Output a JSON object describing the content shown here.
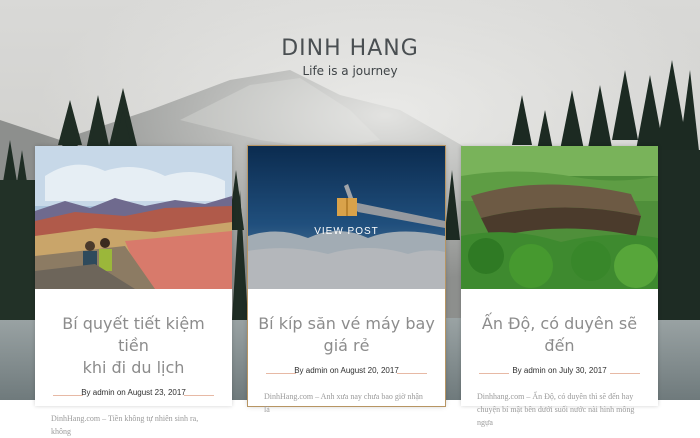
{
  "site": {
    "title": "DINH HANG",
    "tagline": "Life is a journey"
  },
  "colors": {
    "accent_line": "#e7b9a5",
    "title_text": "#4a4f52",
    "view_post_icon": "#d9a24a"
  },
  "posts": [
    {
      "title_line1": "Bí quyết tiết kiệm tiền",
      "title_line2": "khi đi du lịch",
      "by": "By",
      "author": "admin",
      "on": "on",
      "date": "August 23, 2017",
      "excerpt_line1": "DinhHang.com – Tiền không tự nhiên sinh ra, không"
    },
    {
      "title_line1": "Bí kíp săn vé máy bay",
      "title_line2": "giá rẻ",
      "by": "By",
      "author": "admin",
      "on": "on",
      "date": "August 20, 2017",
      "excerpt_line1": "DinhHang.com – Anh xưa nay chưa bao giờ nhận là",
      "overlay_label": "VIEW POST",
      "overlay_icon": "book-icon"
    },
    {
      "title_line1": "Ấn Độ, có duyên sẽ đến",
      "title_line2": "",
      "by": "By",
      "author": "admin",
      "on": "on",
      "date": "July 30, 2017",
      "excerpt_line1": "Dinhhang.com – Ấn Độ, có duyên thì sẽ đến hay",
      "excerpt_line2": "chuyện bí mật bên dưới suối nước nài hình mông ngựa"
    }
  ]
}
